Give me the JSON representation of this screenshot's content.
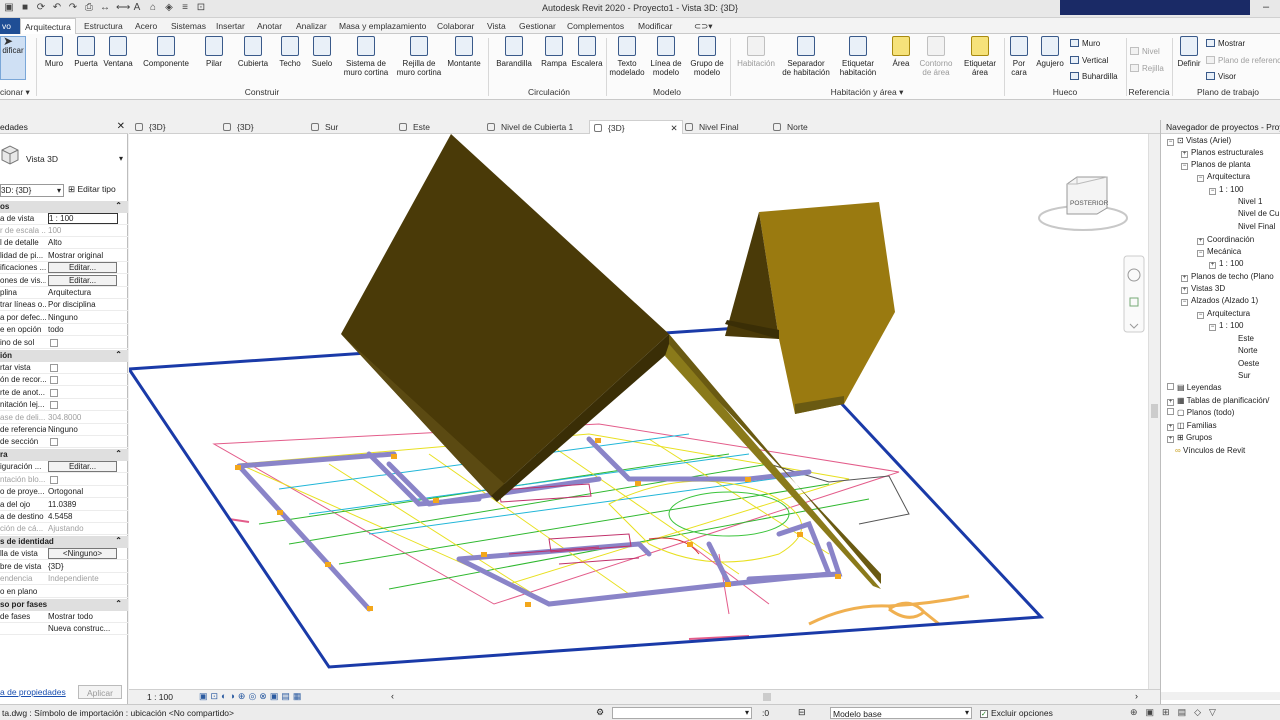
{
  "app": {
    "title": "Autodesk Revit 2020 - Proyecto1 - Vista 3D: {3D}"
  },
  "menu": {
    "file": "vo",
    "tabs": [
      "Arquitectura",
      "Estructura",
      "Acero",
      "Sistemas",
      "Insertar",
      "Anotar",
      "Analizar",
      "Masa y emplazamiento",
      "Colaborar",
      "Vista",
      "Gestionar",
      "Complementos",
      "Modificar"
    ]
  },
  "ribbon": {
    "modify": {
      "label": "dificar",
      "panel": "cionar"
    },
    "tools": [
      {
        "l1": "Muro",
        "l2": ""
      },
      {
        "l1": "Puerta",
        "l2": ""
      },
      {
        "l1": "Ventana",
        "l2": ""
      },
      {
        "l1": "Componente",
        "l2": ""
      },
      {
        "l1": "Pilar",
        "l2": ""
      },
      {
        "l1": "Cubierta",
        "l2": ""
      },
      {
        "l1": "Techo",
        "l2": ""
      },
      {
        "l1": "Suelo",
        "l2": ""
      },
      {
        "l1": "Sistema de",
        "l2": "muro cortina"
      },
      {
        "l1": "Rejilla de",
        "l2": "muro cortina"
      },
      {
        "l1": "Montante",
        "l2": ""
      },
      {
        "l1": "Barandilla",
        "l2": ""
      },
      {
        "l1": "Rampa",
        "l2": ""
      },
      {
        "l1": "Escalera",
        "l2": ""
      },
      {
        "l1": "Texto",
        "l2": "modelado"
      },
      {
        "l1": "Línea de",
        "l2": "modelo"
      },
      {
        "l1": "Grupo de",
        "l2": "modelo"
      },
      {
        "l1": "Habitación",
        "l2": ""
      },
      {
        "l1": "Separador",
        "l2": "de habitación"
      },
      {
        "l1": "Etiquetar",
        "l2": "habitación"
      },
      {
        "l1": "Área",
        "l2": ""
      },
      {
        "l1": "Contorno",
        "l2": "de área"
      },
      {
        "l1": "Etiquetar",
        "l2": "área"
      },
      {
        "l1": "Por",
        "l2": "cara"
      },
      {
        "l1": "Agujero",
        "l2": ""
      },
      {
        "l1": "Definir",
        "l2": ""
      }
    ],
    "small": {
      "muro": "Muro",
      "vertical": "Vertical",
      "buhardilla": "Buhardilla",
      "nivel": "Nivel",
      "rejilla": "Rejilla",
      "mostrar": "Mostrar",
      "plano_ref": "Plano de referencia",
      "visor": "Visor"
    },
    "panels": {
      "construir": "Construir",
      "circulacion": "Circulación",
      "modelo": "Modelo",
      "habitacion": "Habitación y área",
      "hueco": "Hueco",
      "referencia": "Referencia",
      "plano": "Plano de trabajo"
    }
  },
  "properties": {
    "title": "edades",
    "type_name": "Vista 3D",
    "selector": "3D: {3D}",
    "edit_type": "Editar tipo",
    "groups": {
      "graficos": "os",
      "extension": "ión",
      "camara": "ra",
      "identidad": "s de identidad",
      "fases": "so por fases"
    },
    "rows": [
      {
        "l": "a de vista",
        "v": "1 : 100"
      },
      {
        "l": "r de escala ...",
        "v": "100"
      },
      {
        "l": "l de detalle",
        "v": "Alto"
      },
      {
        "l": "lidad de pi...",
        "v": "Mostrar original"
      },
      {
        "l": "ificaciones ...",
        "v": "Editar..."
      },
      {
        "l": "ones de vis...",
        "v": "Editar..."
      },
      {
        "l": "plina",
        "v": "Arquitectura"
      },
      {
        "l": "trar líneas o...",
        "v": "Por disciplina"
      },
      {
        "l": "a por defec...",
        "v": "Ninguno"
      },
      {
        "l": "e en opción",
        "v": "todo"
      },
      {
        "l": "ino de sol",
        "v": ""
      },
      {
        "l": "rtar vista",
        "v": ""
      },
      {
        "l": "ón de recor...",
        "v": ""
      },
      {
        "l": "rte de anot...",
        "v": ""
      },
      {
        "l": "nitación lej...",
        "v": ""
      },
      {
        "l": "ase de deli...",
        "v": "304.8000"
      },
      {
        "l": "de referencia",
        "v": "Ninguno"
      },
      {
        "l": "de sección",
        "v": ""
      },
      {
        "l": "iguración ...",
        "v": "Editar..."
      },
      {
        "l": "ntación blo...",
        "v": ""
      },
      {
        "l": "o de proye...",
        "v": "Ortogonal"
      },
      {
        "l": "a del ojo",
        "v": "11.0389"
      },
      {
        "l": "a de destino",
        "v": "4.5458"
      },
      {
        "l": "ción de cá...",
        "v": "Ajustando"
      },
      {
        "l": "lla de vista",
        "v": "<Ninguno>"
      },
      {
        "l": "bre de vista",
        "v": "{3D}"
      },
      {
        "l": "endencia",
        "v": "Independiente"
      },
      {
        "l": "o en plano",
        "v": ""
      },
      {
        "l": "de fases",
        "v": "Mostrar todo"
      },
      {
        "l": "",
        "v": "Nueva construc..."
      }
    ],
    "help_link": "a de propiedades",
    "apply": "Aplicar"
  },
  "viewtabs": [
    "{3D}",
    "{3D}",
    "Sur",
    "Este",
    "Nivel de Cubierta 1",
    "{3D}",
    "Nivel Final",
    "Norte"
  ],
  "viewcube": {
    "face": "POSTERIOR"
  },
  "viewbar": {
    "scale": "1 : 100"
  },
  "navigator": {
    "title": "Navegador de proyectos - Proy",
    "items": [
      "Vistas (Ariel)",
      "Planos estructurales",
      "Planos de planta",
      "Arquitectura",
      "1 : 100",
      "Nivel 1",
      "Nivel de Cu",
      "Nivel Final",
      "Coordinación",
      "Mecánica",
      "1 : 100",
      "Planos de techo (Plano",
      "Vistas 3D",
      "Alzados (Alzado 1)",
      "Arquitectura",
      "1 : 100",
      "Este",
      "Norte",
      "Oeste",
      "Sur",
      "Leyendas",
      "Tablas de planificación/",
      "Planos (todo)",
      "Familias",
      "Grupos",
      "Vínculos de Revit"
    ]
  },
  "status": {
    "message": "ta.dwg : Símbolo de importación : ubicación <No compartido>",
    "zero": ":0",
    "model": "Modelo base",
    "exclude": "Excluir opciones"
  },
  "colors": {
    "accent": "#1f4e95",
    "roof_dark": "#4a3a08",
    "roof_gold": "#9a7a10",
    "level_line": "#1a3aa8"
  }
}
